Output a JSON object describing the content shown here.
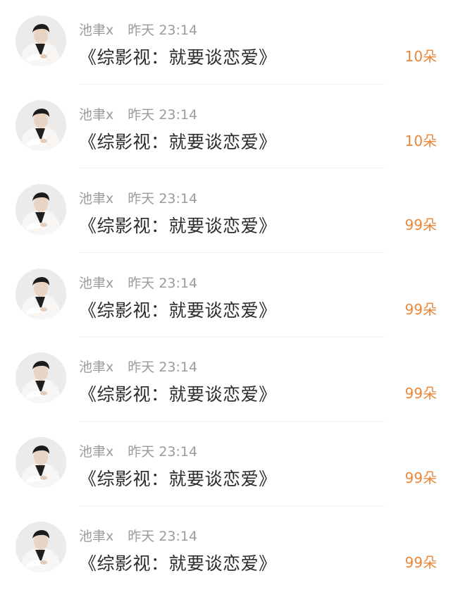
{
  "comments": [
    {
      "author": "池聿x",
      "time": "昨天 23:14",
      "content": "《综影视：就要谈恋爱》",
      "flowers": "10朵"
    },
    {
      "author": "池聿x",
      "time": "昨天 23:14",
      "content": "《综影视：就要谈恋爱》",
      "flowers": "10朵"
    },
    {
      "author": "池聿x",
      "time": "昨天 23:14",
      "content": "《综影视：就要谈恋爱》",
      "flowers": "99朵"
    },
    {
      "author": "池聿x",
      "time": "昨天 23:14",
      "content": "《综影视：就要谈恋爱》",
      "flowers": "99朵"
    },
    {
      "author": "池聿x",
      "time": "昨天 23:14",
      "content": "《综影视：就要谈恋爱》",
      "flowers": "99朵"
    },
    {
      "author": "池聿x",
      "time": "昨天 23:14",
      "content": "《综影视：就要谈恋爱》",
      "flowers": "99朵"
    },
    {
      "author": "池聿x",
      "time": "昨天 23:14",
      "content": "《综影视：就要谈恋爱》",
      "flowers": "99朵"
    }
  ],
  "colors": {
    "meta_text": "#9b9b9b",
    "content_text": "#2b2b2b",
    "flower_accent": "#e8873a",
    "divider": "#f0f0f0"
  }
}
